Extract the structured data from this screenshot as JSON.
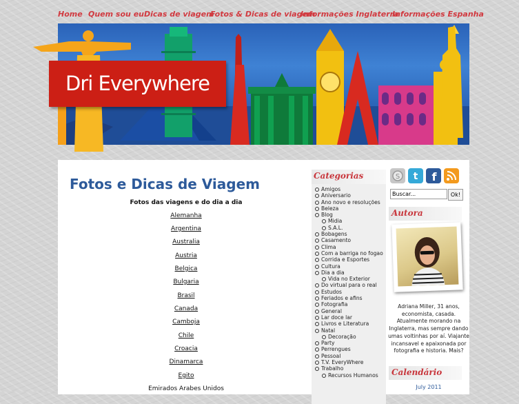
{
  "nav": {
    "items": [
      {
        "label": "Home"
      },
      {
        "label": "Quem sou eu"
      },
      {
        "label": "Dicas de viagem"
      },
      {
        "label": "Fotos & Dicas de viagem"
      },
      {
        "label": "Informações Inglaterra"
      },
      {
        "label": "Informações Espanha"
      }
    ]
  },
  "header": {
    "logo_text": "Dri Everywhere"
  },
  "main": {
    "title": "Fotos e Dicas de Viagem",
    "subtitle": "Fotos das viagens e do dia a dia",
    "countries": [
      "Alemanha",
      "Argentina",
      "Australia",
      "Austria",
      "Belgica",
      "Bulgaria",
      "Brasil",
      "Canada",
      "Camboja",
      "Chile",
      "Croacia",
      "Dinamarca",
      "Egito",
      "Emirados Arabes Unidos"
    ]
  },
  "categories": {
    "heading": "Categorias",
    "items": [
      {
        "label": "Amigos",
        "level": 0
      },
      {
        "label": "Aniversario",
        "level": 0
      },
      {
        "label": "Ano novo e resoluções",
        "level": 0
      },
      {
        "label": "Beleza",
        "level": 0
      },
      {
        "label": "Blog",
        "level": 0
      },
      {
        "label": "Midia",
        "level": 1
      },
      {
        "label": "S.A.L.",
        "level": 1
      },
      {
        "label": "Bobagens",
        "level": 0
      },
      {
        "label": "Casamento",
        "level": 0
      },
      {
        "label": "Clima",
        "level": 0
      },
      {
        "label": "Com a barriga no fogao",
        "level": 0
      },
      {
        "label": "Corrida e Esportes",
        "level": 0
      },
      {
        "label": "Cultura",
        "level": 0
      },
      {
        "label": "Dia a dia",
        "level": 0
      },
      {
        "label": "Vida no Exterior",
        "level": 1
      },
      {
        "label": "Do virtual para o real",
        "level": 0
      },
      {
        "label": "Estudos",
        "level": 0
      },
      {
        "label": "Feriados e afins",
        "level": 0
      },
      {
        "label": "Fotografia",
        "level": 0
      },
      {
        "label": "General",
        "level": 0
      },
      {
        "label": "Lar doce lar",
        "level": 0
      },
      {
        "label": "Livros e Literatura",
        "level": 0
      },
      {
        "label": "Natal",
        "level": 0
      },
      {
        "label": "Decoração",
        "level": 1
      },
      {
        "label": "Party",
        "level": 0
      },
      {
        "label": "Perrengues",
        "level": 0
      },
      {
        "label": "Pessoal",
        "level": 0
      },
      {
        "label": "T.V. EveryWhere",
        "level": 0
      },
      {
        "label": "Trabalho",
        "level": 0
      },
      {
        "label": "Recursos Humanos",
        "level": 1
      }
    ]
  },
  "sidebar": {
    "social": [
      {
        "icon": "skype-icon",
        "color": "#bdbdbd"
      },
      {
        "icon": "twitter-icon",
        "color": "#35a9d8"
      },
      {
        "icon": "facebook-icon",
        "color": "#2d5a9a"
      },
      {
        "icon": "rss-icon",
        "color": "#f39a1e"
      }
    ],
    "search_value": "Buscar...",
    "search_button": "Ok!",
    "autora_heading": "Autora",
    "bio": "Adriana Miller, 31 anos, economista, casada. Atualmente morando na Inglaterra, mas sempre dando umas voltinhas por aí. Viajante incansavel e apaixonada por fotografia e historia. Mais?",
    "calendar_heading": "Calendário",
    "calendar_month": "July 2011"
  },
  "colors": {
    "accent": "#d13a40",
    "title_blue": "#2d5a9a",
    "logo_red": "#cc1f15"
  }
}
